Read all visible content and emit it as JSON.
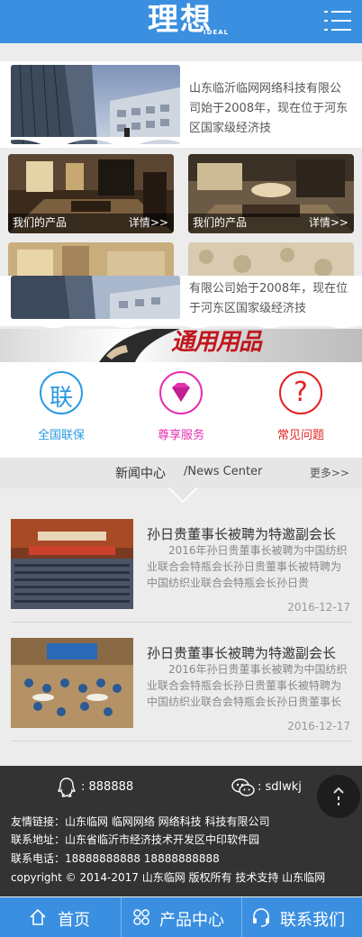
{
  "header": {
    "logo_text": "理想",
    "logo_sub": "IDEAL",
    "menu_icon": "hamburger-menu-icon",
    "accent_color": "#3a8fe0"
  },
  "intro": {
    "text_top": "山东临沂临网网络科技有限公司始于2008年，现在位于河东区国家级经济技",
    "text_bottom": "有限公司始于2008年，现在位于河东区国家级经济技"
  },
  "products": [
    {
      "name": "我们的产品",
      "more": "详情>>"
    },
    {
      "name": "我们的产品",
      "more": "详情>>"
    }
  ],
  "banner": {
    "text": "通用用品"
  },
  "services": [
    {
      "label": "全国联保",
      "glyph": "联",
      "color": "#2a9be3",
      "icon": "lian-badge-icon"
    },
    {
      "label": "尊享服务",
      "glyph": "◆",
      "color": "#e52fb0",
      "icon": "diamond-icon"
    },
    {
      "label": "常见问题",
      "glyph": "?",
      "color": "#e02424",
      "icon": "question-icon"
    }
  ],
  "news": {
    "title": "新闻中心",
    "title_en": "/News Center",
    "more": "更多>>",
    "items": [
      {
        "title": "孙日贵董事长被聘为特邀副会长",
        "desc": "2016年孙日贵董事长被聘为中国纺织业联合会特瓶会长孙日贵董事长被特聘为中国纺织业联合会特瓶会长孙日贵",
        "date": "2016-12-17"
      },
      {
        "title": "孙日贵董事长被聘为特邀副会长",
        "desc": "2016年孙日贵董事长被聘为中国纺织业联合会特瓶会长孙日贵董事长被特聘为中国纺织业联合会特瓶会长孙日贵董事长被",
        "date": "2016-12-17"
      }
    ]
  },
  "footer": {
    "qq": ": 888888",
    "wechat": ": sdlwkj",
    "links": "友情链接：山东临网  临网网络  网络科技  科技有限公司",
    "address": "联系地址：山东省临沂市经济技术开发区中印软件园",
    "phone": "联系电话：18888888888  18888888888",
    "copyright": "copyright © 2014-2017 山东临网 版权所有 技术支持 山东临网"
  },
  "bottom_nav": [
    {
      "label": "首页",
      "icon": "home-icon"
    },
    {
      "label": "产品中心",
      "icon": "clover-icon"
    },
    {
      "label": "联系我们",
      "icon": "headset-icon"
    }
  ]
}
